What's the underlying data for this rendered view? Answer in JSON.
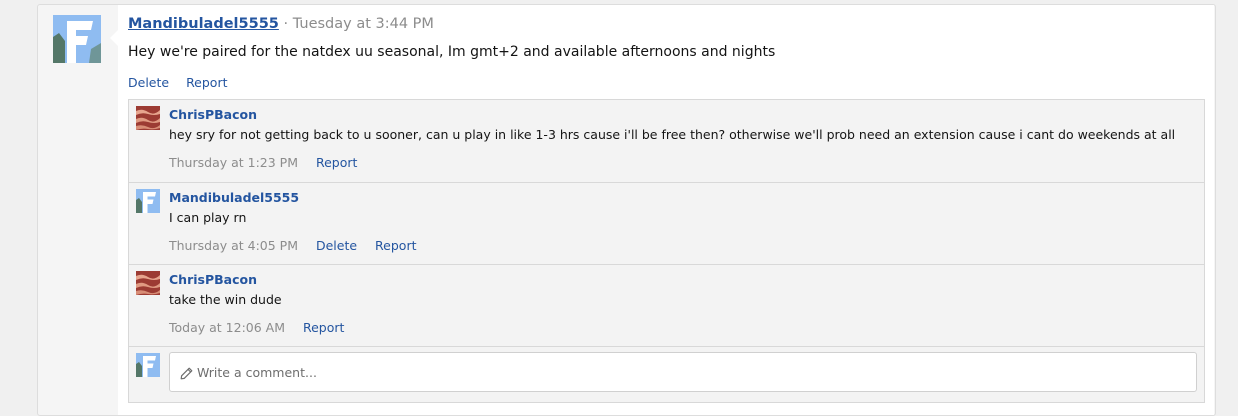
{
  "post": {
    "username": "Mandibuladel5555",
    "separator": "·",
    "time": "Tuesday at 3:44 PM",
    "body": "Hey we're paired for the natdex uu seasonal, Im gmt+2 and available afternoons and nights",
    "actions": {
      "delete": "Delete",
      "report": "Report"
    }
  },
  "comments": [
    {
      "username": "ChrisPBacon",
      "text": "hey sry for not getting back to u sooner, can u play in like 1-3 hrs cause i'll be free then? otherwise we'll prob need an extension cause i cant do weekends at all",
      "time": "Thursday at 1:23 PM",
      "report": "Report"
    },
    {
      "username": "Mandibuladel5555",
      "text": "I can play rn",
      "time": "Thursday at 4:05 PM",
      "delete": "Delete",
      "report": "Report"
    },
    {
      "username": "ChrisPBacon",
      "text": "take the win dude",
      "time": "Today at 12:06 AM",
      "report": "Report"
    }
  ],
  "reply": {
    "placeholder": "Write a comment..."
  },
  "icons": {
    "avatar_f": "letter-f-avatar-icon",
    "avatar_bacon": "bacon-avatar-icon",
    "pencil": "pencil-icon"
  },
  "colors": {
    "link": "#2455a0",
    "muted": "#8c8c8c",
    "avatar_blue": "#8fbcf1",
    "comment_bg": "#f3f3f3"
  }
}
